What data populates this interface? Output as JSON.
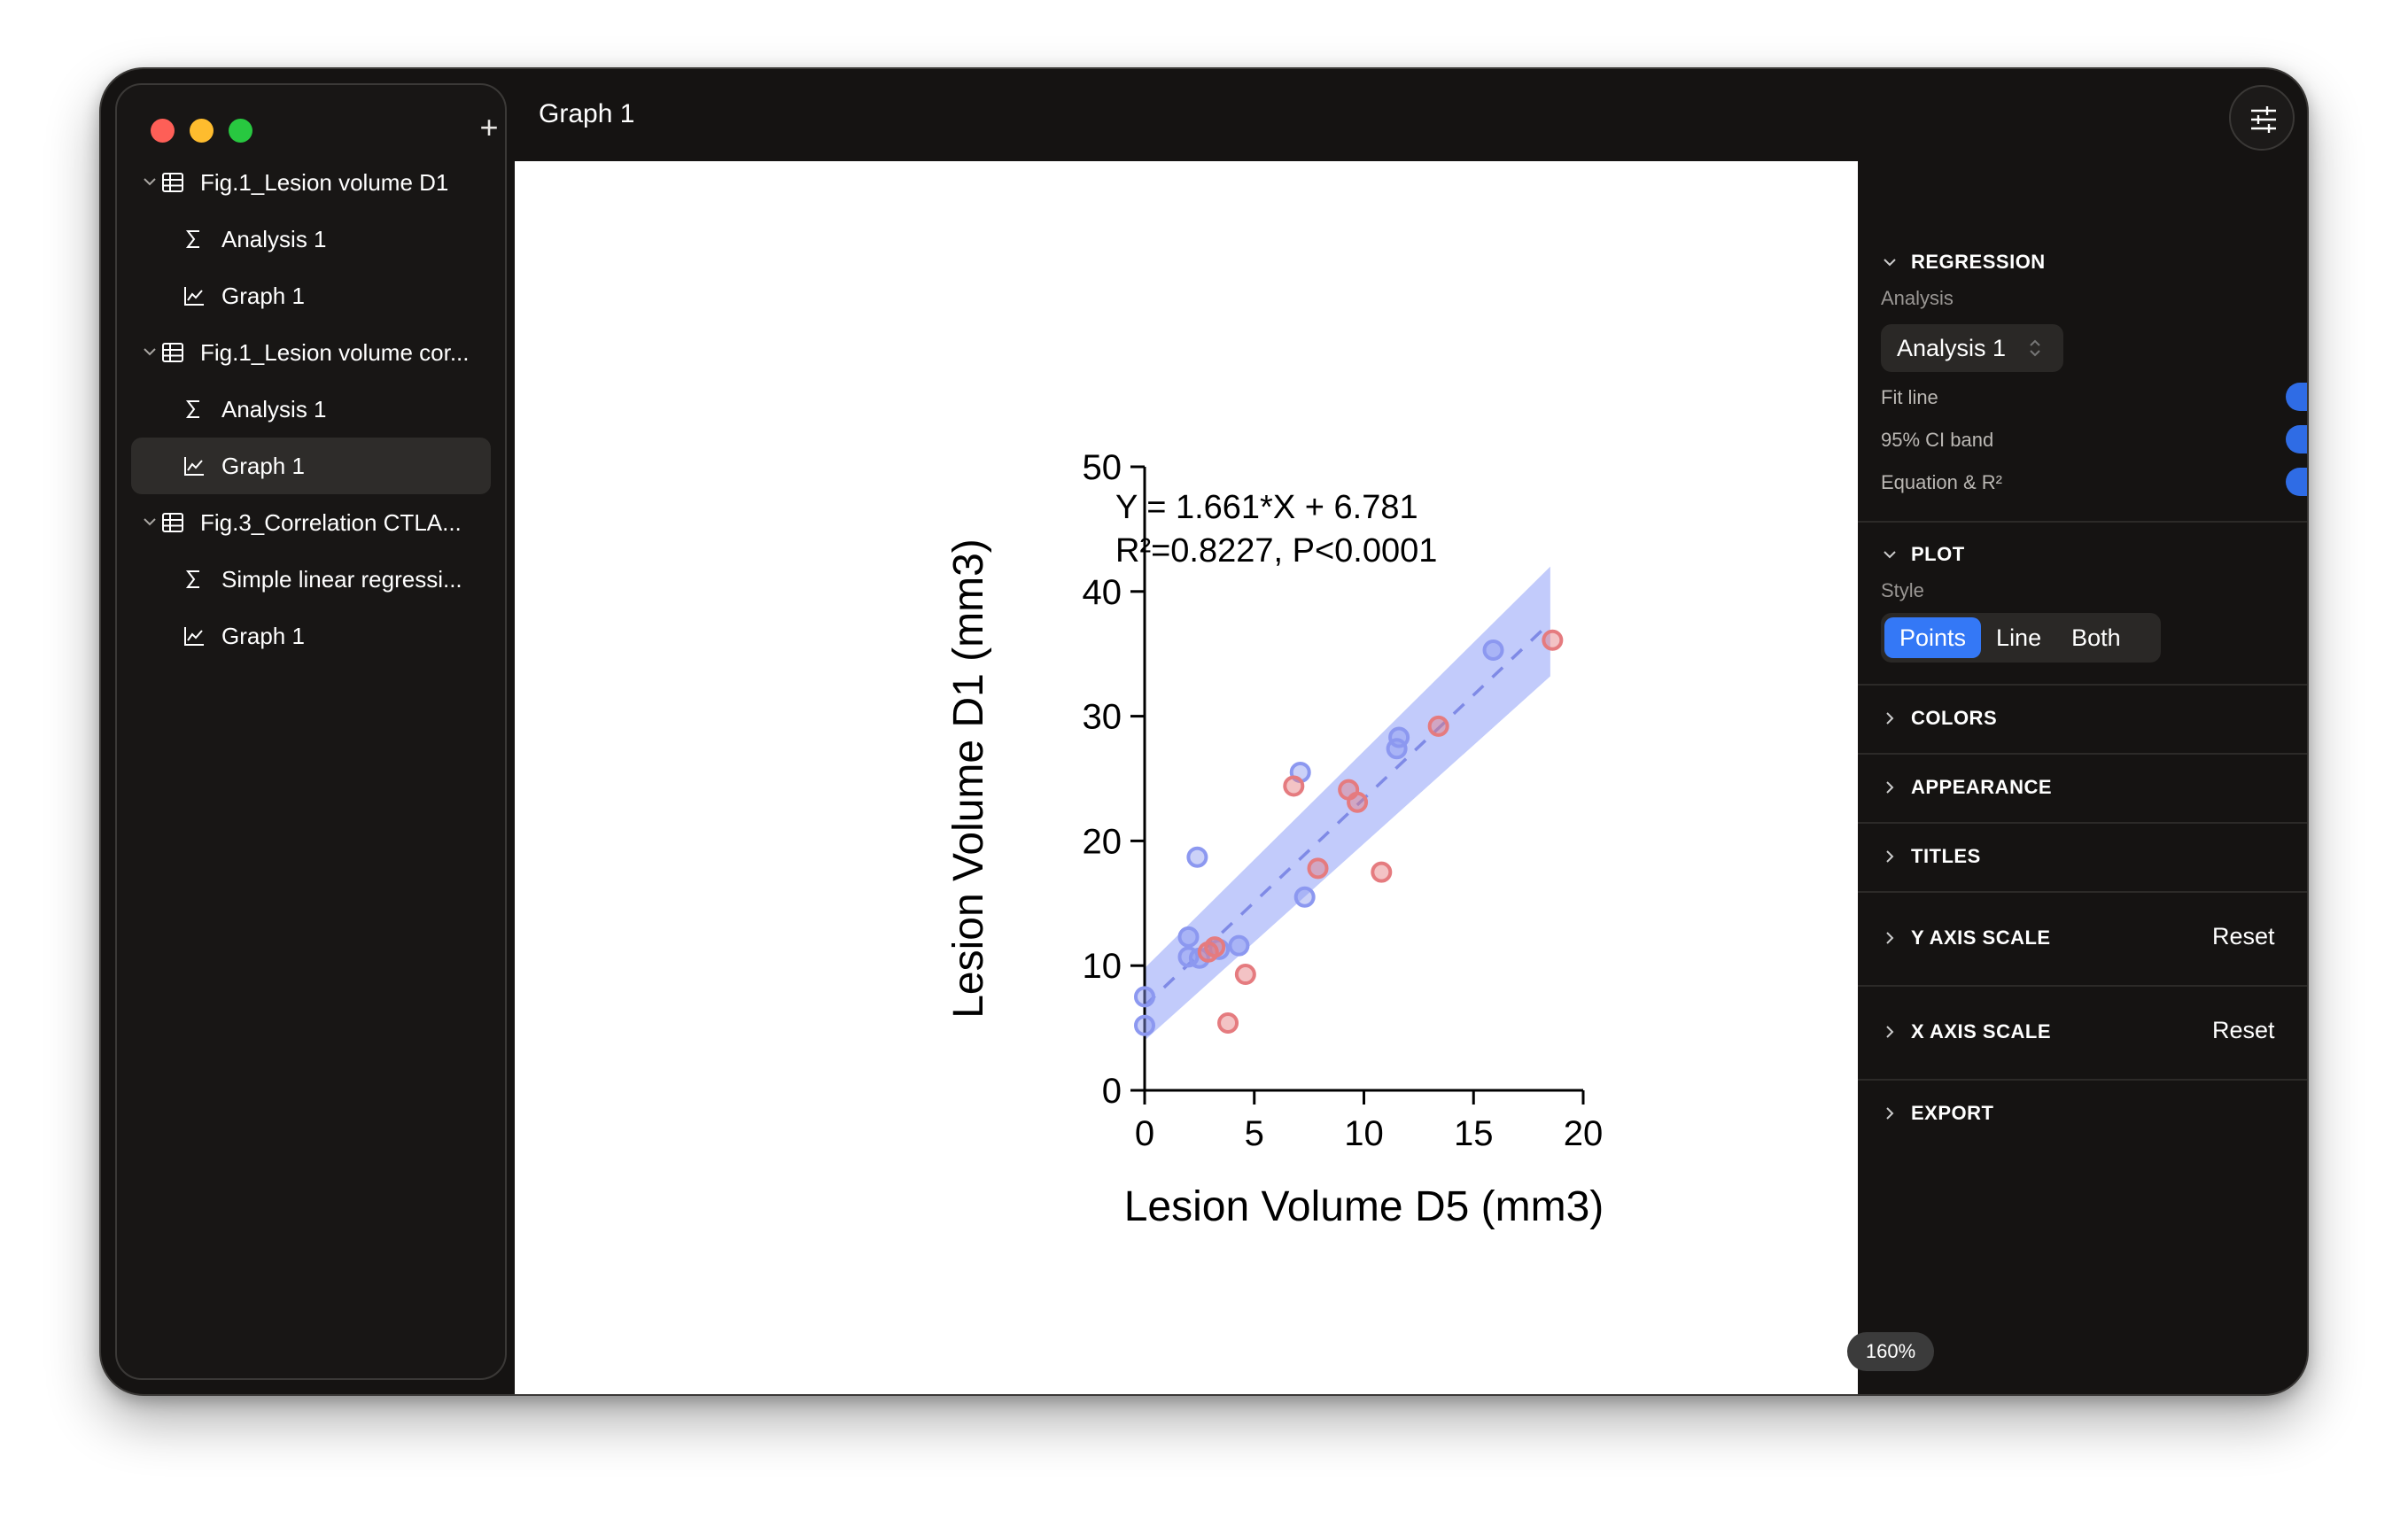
{
  "window": {
    "title": "Graph 1"
  },
  "sidebar": {
    "add_icon": "plus-icon",
    "items": [
      {
        "label": "Fig.1_Lesion volume D1",
        "type": "table",
        "level": 0
      },
      {
        "label": "Analysis 1",
        "type": "analysis",
        "level": 1
      },
      {
        "label": "Graph 1",
        "type": "graph",
        "level": 1
      },
      {
        "label": "Fig.1_Lesion volume cor...",
        "type": "table",
        "level": 0
      },
      {
        "label": "Analysis 1",
        "type": "analysis",
        "level": 1
      },
      {
        "label": "Graph 1",
        "type": "graph",
        "level": 1,
        "selected": true
      },
      {
        "label": "Fig.3_Correlation CTLA...",
        "type": "table",
        "level": 0
      },
      {
        "label": "Simple linear regressi...",
        "type": "analysis",
        "level": 1
      },
      {
        "label": "Graph 1",
        "type": "graph",
        "level": 1
      }
    ]
  },
  "canvas": {
    "zoom": "160%"
  },
  "panel": {
    "regression": {
      "header": "REGRESSION",
      "analysis_label": "Analysis",
      "analysis_value": "Analysis 1",
      "fit_line": "Fit line",
      "ci_band": "95% CI band",
      "equation": "Equation & R²",
      "fit_line_on": true,
      "ci_band_on": true,
      "equation_on": true
    },
    "plot": {
      "header": "PLOT",
      "style_label": "Style",
      "styles": [
        "Points",
        "Line",
        "Both"
      ],
      "selected": "Points"
    },
    "colors": "COLORS",
    "appearance": "APPEARANCE",
    "titles": "TITLES",
    "y_axis_scale": "Y AXIS SCALE",
    "x_axis_scale": "X AXIS SCALE",
    "reset": "Reset",
    "export": "EXPORT"
  },
  "colors": {
    "accent": "#3478f6",
    "series_blue": "#8c98f0",
    "series_red": "#e57b7f",
    "ci_band": "#b7c2fa"
  },
  "chart_data": {
    "type": "scatter",
    "xlabel": "Lesion Volume D5 (mm3)",
    "ylabel": "Lesion Volume D1 (mm3)",
    "xlim": [
      0,
      20
    ],
    "ylim": [
      0,
      50
    ],
    "xticks": [
      0,
      5,
      10,
      15,
      20
    ],
    "yticks": [
      0,
      10,
      20,
      30,
      40,
      50
    ],
    "equation": "Y = 1.661*X + 6.781",
    "stats": "R²=0.8227, P<0.0001",
    "fit": {
      "slope": 1.661,
      "intercept": 6.781,
      "x_range": [
        0,
        18.5
      ]
    },
    "ci_band": {
      "x": [
        0,
        18.5
      ],
      "lower": [
        4.0,
        33.2
      ],
      "upper": [
        9.8,
        42.0
      ]
    },
    "series": [
      {
        "color": "#8c98f0",
        "points": [
          [
            0.0,
            7.5
          ],
          [
            0.0,
            5.2
          ],
          [
            2.0,
            10.7
          ],
          [
            2.0,
            12.3
          ],
          [
            2.4,
            18.7
          ],
          [
            2.5,
            10.6
          ],
          [
            3.4,
            11.3
          ],
          [
            4.3,
            11.6
          ],
          [
            7.1,
            25.5
          ],
          [
            7.3,
            15.5
          ],
          [
            11.5,
            27.4
          ],
          [
            11.6,
            28.3
          ],
          [
            15.9,
            35.3
          ]
        ]
      },
      {
        "color": "#e57b7f",
        "points": [
          [
            2.9,
            11.1
          ],
          [
            3.2,
            11.5
          ],
          [
            3.8,
            5.4
          ],
          [
            4.6,
            9.3
          ],
          [
            6.8,
            24.4
          ],
          [
            7.9,
            17.8
          ],
          [
            9.3,
            24.1
          ],
          [
            9.7,
            23.1
          ],
          [
            10.8,
            17.5
          ],
          [
            13.4,
            29.2
          ],
          [
            18.6,
            36.1
          ]
        ]
      }
    ]
  }
}
